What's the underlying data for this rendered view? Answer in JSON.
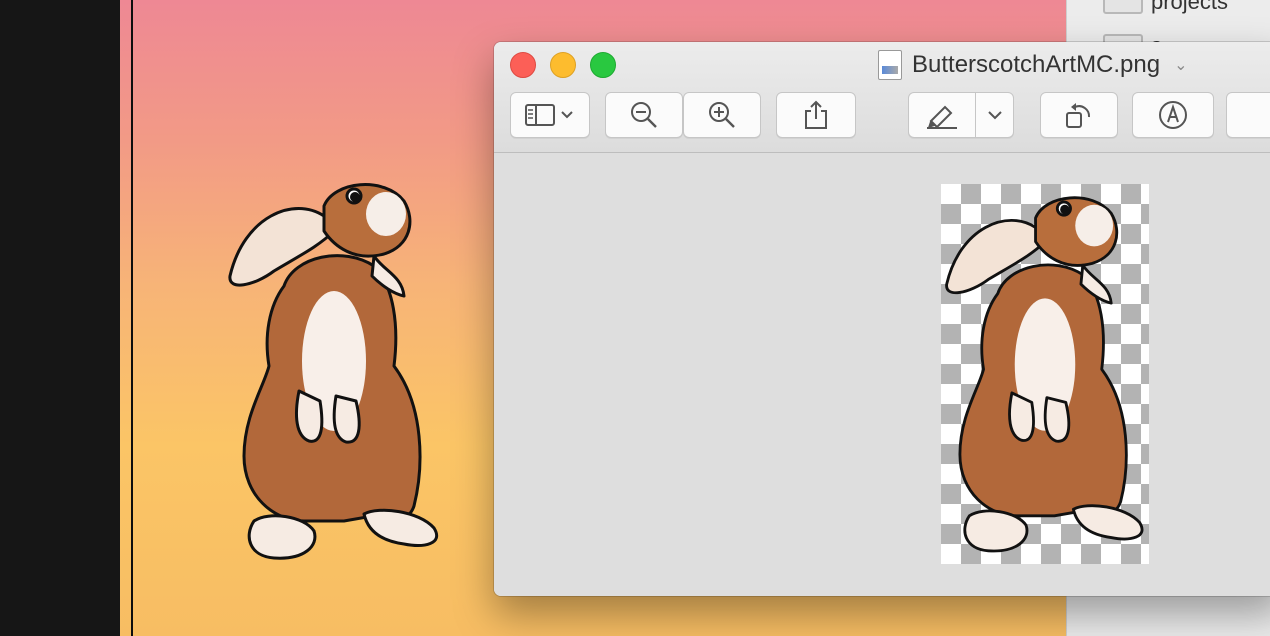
{
  "window": {
    "title": "ButterscotchArtMC.png",
    "title_chevron": "⌄"
  },
  "toolbar": {
    "sidebar_button": "sidebar-icon",
    "zoom_out_button": "zoom-out-icon",
    "zoom_in_button": "zoom-in-icon",
    "share_button": "share-icon",
    "markup_button": "highlighter-icon",
    "rotate_button": "rotate-icon",
    "annotate_button": "markup-pen-icon"
  },
  "finder": {
    "items": [
      {
        "label": "projects",
        "icon": "folder-icon"
      },
      {
        "label": "s",
        "icon": "folder-icon"
      }
    ]
  },
  "colors": {
    "gradient_top": "#ee8894",
    "gradient_bottom": "#f7bd63",
    "close": "#fc5f57",
    "minimize": "#fdbc2e",
    "maximize": "#29c840"
  }
}
